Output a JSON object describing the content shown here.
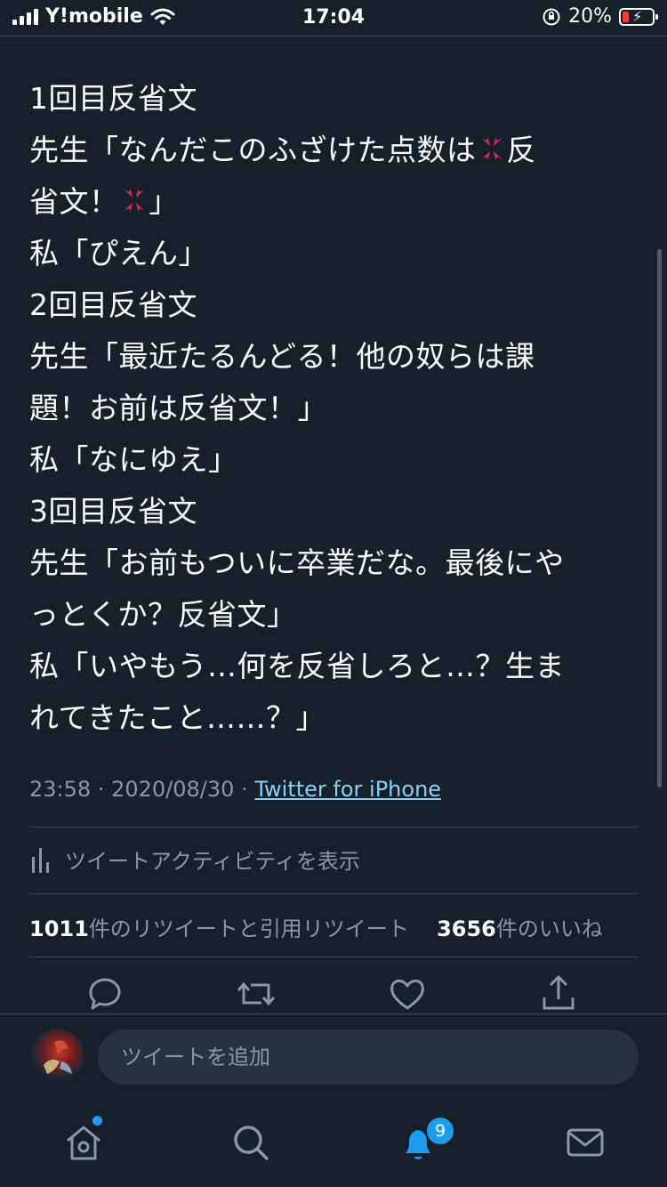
{
  "status_bar": {
    "carrier": "Y!mobile",
    "time": "17:04",
    "battery_percent": "20%",
    "battery_level": 0.2,
    "icons": [
      "signal-icon",
      "wifi-icon",
      "orientation-lock-icon",
      "battery-charging-icon"
    ]
  },
  "tweet": {
    "lines": [
      "1回目反省文",
      "先生「なんだこのふざけた点数は",
      "反",
      "省文！",
      "」",
      "私「ぴえん」",
      "2回目反省文",
      "先生「最近たるんどる！他の奴らは課",
      "題！お前は反省文！」",
      "私「なにゆえ」",
      "3回目反省文",
      "先生「お前もついに卒業だな。最後にや",
      "っとくか？反省文」",
      "私「いやもう…何を反省しろと…？生ま",
      "れてきたこと……？」"
    ],
    "time": "23:58",
    "date": "2020/08/30",
    "separator": "·",
    "source": "Twitter for iPhone",
    "activity_label": "ツイートアクティビティを表示",
    "retweet_count": "1011",
    "retweet_label": "件のリツイートと引用リツイート",
    "like_count": "3656",
    "like_label": "件のいいね"
  },
  "actions": [
    "reply-icon",
    "retweet-icon",
    "like-icon",
    "share-icon"
  ],
  "reply_box": {
    "placeholder": "ツイートを追加"
  },
  "tab_bar": {
    "tabs": [
      "home-icon",
      "search-icon",
      "notifications-icon",
      "messages-icon"
    ],
    "notification_badge": "9"
  },
  "colors": {
    "background": "#15202b",
    "accent": "#1d9bf0",
    "muted": "#8899a6",
    "link": "#8ecdf8",
    "anger": "#e0245e"
  }
}
